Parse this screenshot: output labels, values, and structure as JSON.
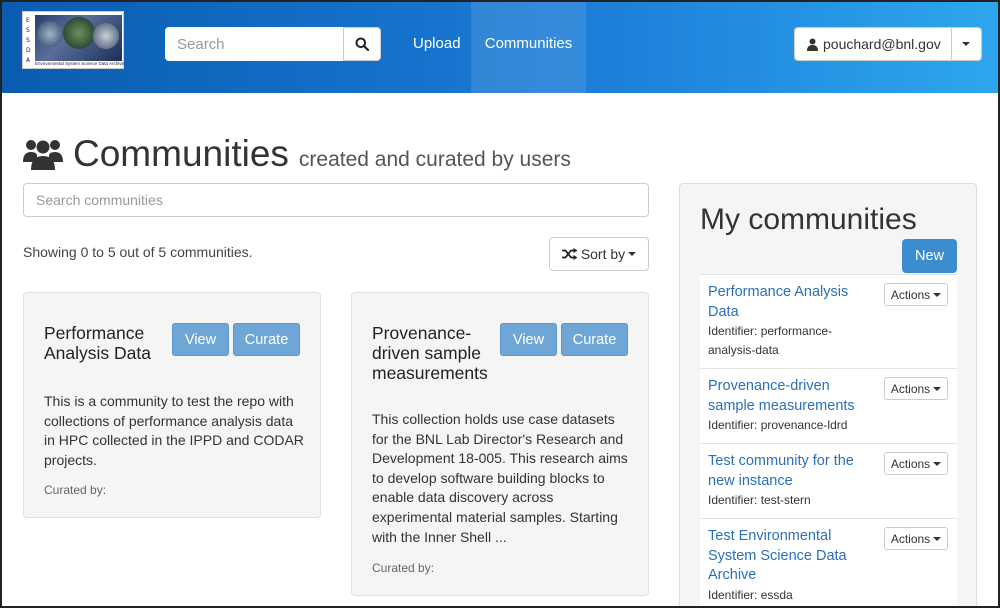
{
  "header": {
    "logo_letters": [
      "E",
      "S",
      "S",
      "D",
      "A"
    ],
    "logo_caption": "Environmental System Science Data Archive",
    "search_placeholder": "Search",
    "nav": {
      "upload": "Upload",
      "communities": "Communities"
    },
    "user_email": "pouchard@bnl.gov"
  },
  "page": {
    "title": "Communities",
    "subtitle": "created and curated by users",
    "search_placeholder": "Search communities",
    "showing_text": "Showing 0 to 5 out of 5 communities.",
    "sort_label": "Sort by"
  },
  "cards": [
    {
      "title": "Performance Analysis Data",
      "view_label": "View",
      "curate_label": "Curate",
      "description": "This is a community to test the repo with collections of performance analysis data in HPC collected in the IPPD and CODAR projects.",
      "curated_by": "Curated by:"
    },
    {
      "title": "Provenance-driven sample measurements",
      "view_label": "View",
      "curate_label": "Curate",
      "description": "This collection holds use case datasets for the BNL Lab Director's Research and Development 18-005.  This research aims to develop software building blocks to enable data discovery across experimental material samples.  Starting with the Inner Shell ...",
      "curated_by": "Curated by:"
    }
  ],
  "sidebar": {
    "title": "My communities",
    "new_label": "New",
    "actions_label": "Actions",
    "items": [
      {
        "name": "Performance Analysis Data",
        "identifier": "Identifier: performance-analysis-data"
      },
      {
        "name": "Provenance-driven sample measurements",
        "identifier": "Identifier: provenance-ldrd"
      },
      {
        "name": "Test community for the new instance",
        "identifier": "Identifier: test-stern"
      },
      {
        "name": "Test Environmental System Science Data Archive",
        "identifier": "Identifier: essda"
      }
    ]
  },
  "colors": {
    "header_start": "#0a5cb0",
    "header_end": "#2ea6ee",
    "primary_button": "#3c8dd0",
    "light_button": "#6ea6d6",
    "link": "#2a70b9"
  }
}
